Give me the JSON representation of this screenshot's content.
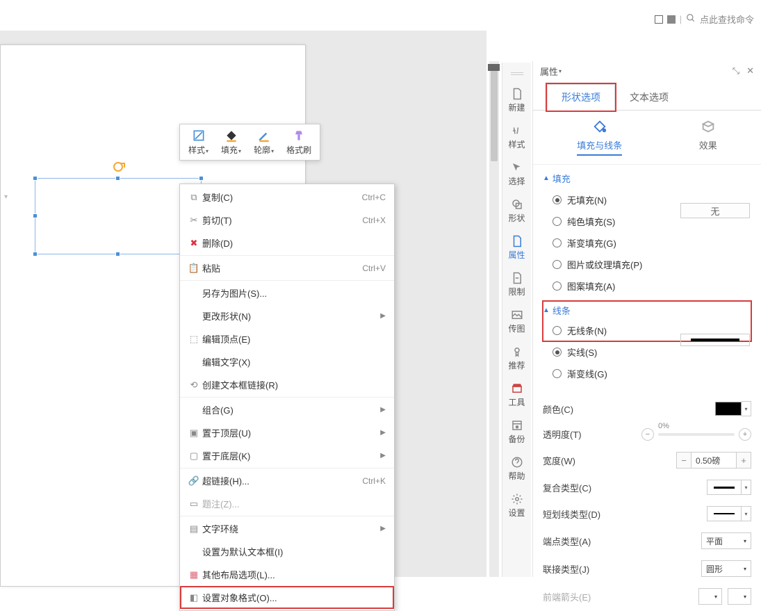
{
  "topbar": {
    "search_placeholder": "点此查找命令"
  },
  "floatbar": {
    "style": "样式",
    "fill": "填充",
    "outline": "轮廓",
    "format_painter": "格式刷"
  },
  "context_menu": {
    "copy": "复制(C)",
    "copy_sc": "Ctrl+C",
    "cut": "剪切(T)",
    "cut_sc": "Ctrl+X",
    "delete": "删除(D)",
    "paste": "粘贴",
    "paste_sc": "Ctrl+V",
    "save_as_pic": "另存为图片(S)...",
    "change_shape": "更改形状(N)",
    "edit_points": "编辑顶点(E)",
    "edit_text": "编辑文字(X)",
    "create_textbox_link": "创建文本框链接(R)",
    "group": "组合(G)",
    "to_front": "置于顶层(U)",
    "to_back": "置于底层(K)",
    "hyperlink": "超链接(H)...",
    "hyperlink_sc": "Ctrl+K",
    "comment": "题注(Z)...",
    "text_wrap": "文字环绕",
    "set_default_textbox": "设置为默认文本框(I)",
    "other_layout": "其他布局选项(L)...",
    "object_format": "设置对象格式(O)..."
  },
  "vstrip": {
    "new": "新建",
    "style": "样式",
    "select": "选择",
    "shape": "形状",
    "property": "属性",
    "limit": "限制",
    "image": "传图",
    "recommend": "推荐",
    "tools": "工具",
    "backup": "备份",
    "help": "帮助",
    "settings": "设置"
  },
  "panel": {
    "title": "属性",
    "tab_shape": "形状选项",
    "tab_text": "文本选项",
    "sub_fill_line": "填充与线条",
    "sub_effect": "效果",
    "sec_fill": "填充",
    "none_btn": "无",
    "fill_opts": {
      "none": "无填充(N)",
      "solid": "纯色填充(S)",
      "gradient": "渐变填充(G)",
      "picture": "图片或纹理填充(P)",
      "pattern": "图案填充(A)"
    },
    "sec_line": "线条",
    "line_opts": {
      "none": "无线条(N)",
      "solid": "实线(S)",
      "gradient": "渐变线(G)"
    },
    "props": {
      "color": "颜色(C)",
      "transparency": "透明度(T)",
      "transparency_val": "0%",
      "width": "宽度(W)",
      "width_val": "0.50磅",
      "compound": "复合类型(C)",
      "dash": "短划线类型(D)",
      "cap": "端点类型(A)",
      "cap_val": "平面",
      "join": "联接类型(J)",
      "join_val": "圆形",
      "arrow_begin": "前端箭头(E)"
    }
  }
}
